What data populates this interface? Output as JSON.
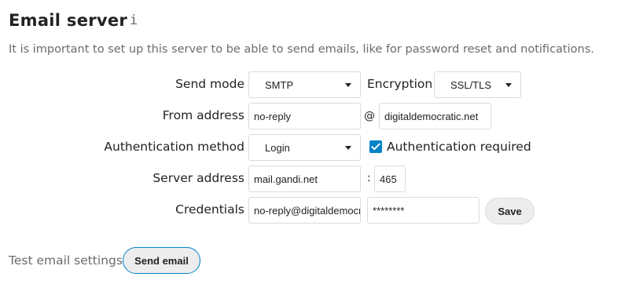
{
  "section": {
    "title": "Email server",
    "description": "It is important to set up this server to be able to send emails, like for password reset and notifications."
  },
  "send_mode": {
    "label": "Send mode",
    "value": "SMTP"
  },
  "encryption": {
    "label": "Encryption",
    "value": "SSL/TLS"
  },
  "from_address": {
    "label": "From address",
    "local_part": "no-reply",
    "at": "@",
    "domain": "digitaldemocratic.net"
  },
  "auth_method": {
    "label": "Authentication method",
    "value": "Login"
  },
  "auth_required": {
    "label": "Authentication required",
    "checked": true
  },
  "server_address": {
    "label": "Server address",
    "host": "mail.gandi.net",
    "colon": ":",
    "port": "465"
  },
  "credentials": {
    "label": "Credentials",
    "username": "no-reply@digitaldemocratic.net",
    "password": "********",
    "save_label": "Save"
  },
  "test": {
    "label": "Test email settings",
    "button_label": "Send email"
  },
  "colors": {
    "accent": "#0082c9",
    "button_bg": "#ededed",
    "muted_text": "#6b6b6b"
  },
  "icons": {
    "info": "info-icon",
    "checkbox": "checkmark-icon"
  }
}
